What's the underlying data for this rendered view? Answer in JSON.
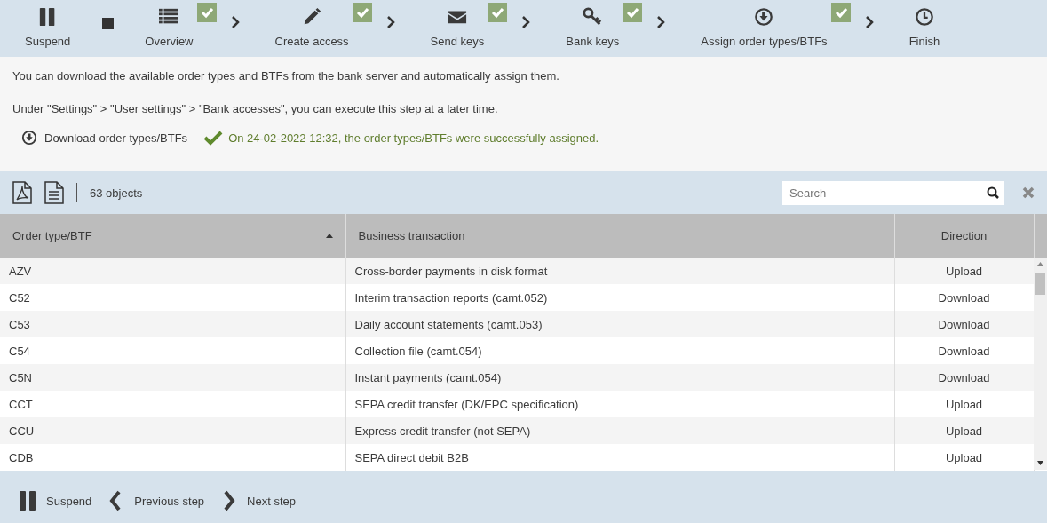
{
  "wizard": {
    "suspend": {
      "label": "Suspend"
    },
    "steps": [
      {
        "kind": "list",
        "label": "Overview",
        "done": true
      },
      {
        "kind": "pencil",
        "label": "Create access",
        "done": true
      },
      {
        "kind": "envelope",
        "label": "Send keys",
        "done": true
      },
      {
        "kind": "key",
        "label": "Bank keys",
        "done": true
      },
      {
        "kind": "download",
        "label": "Assign order types/BTFs",
        "done": true
      },
      {
        "kind": "clock",
        "label": "Finish",
        "done": false
      }
    ]
  },
  "info": {
    "lines": [
      "You can download the available order types and BTFs from the bank server and automatically assign them.",
      "Under \"Settings\" > \"User settings\" > \"Bank accesses\", you can execute this step at a later time."
    ],
    "download_link": "Download order types/BTFs",
    "success": "On 24-02-2022 12:32, the order types/BTFs were successfully assigned."
  },
  "toolbar": {
    "count": "63 objects",
    "search": {
      "placeholder": "Search"
    }
  },
  "table": {
    "columns": [
      {
        "label": "Order type/BTF",
        "sorted": true
      },
      {
        "label": "Business transaction",
        "sorted": false
      },
      {
        "label": "Direction",
        "sorted": false
      }
    ],
    "rows": [
      [
        "AZV",
        "Cross-border payments in disk format",
        "Upload"
      ],
      [
        "C52",
        "Interim transaction reports (camt.052)",
        "Download"
      ],
      [
        "C53",
        "Daily account statements (camt.053)",
        "Download"
      ],
      [
        "C54",
        "Collection file (camt.054)",
        "Download"
      ],
      [
        "C5N",
        "Instant payments (camt.054)",
        "Download"
      ],
      [
        "CCT",
        "SEPA credit transfer (DK/EPC specification)",
        "Upload"
      ],
      [
        "CCU",
        "Express credit transfer (not SEPA)",
        "Upload"
      ],
      [
        "CDB",
        "SEPA direct debit B2B",
        "Upload"
      ]
    ]
  },
  "footer": {
    "buttons": [
      {
        "kind": "pause",
        "label": "Suspend"
      },
      {
        "kind": "prev",
        "label": "Previous step"
      },
      {
        "kind": "next",
        "label": "Next step"
      }
    ]
  }
}
